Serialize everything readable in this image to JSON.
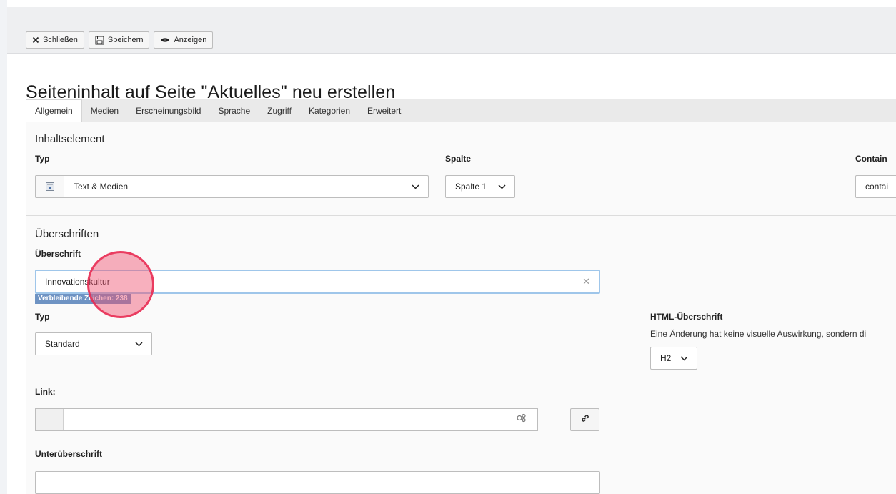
{
  "toolbar": {
    "close_label": "Schließen",
    "save_label": "Speichern",
    "view_label": "Anzeigen"
  },
  "page_title": "Seiteninhalt auf Seite \"Aktuelles\" neu erstellen",
  "tabs": [
    {
      "label": "Allgemein"
    },
    {
      "label": "Medien"
    },
    {
      "label": "Erscheinungsbild"
    },
    {
      "label": "Sprache"
    },
    {
      "label": "Zugriff"
    },
    {
      "label": "Kategorien"
    },
    {
      "label": "Erweitert"
    }
  ],
  "content_element": {
    "section_title": "Inhaltselement",
    "type_label": "Typ",
    "type_value": "Text & Medien",
    "column_label": "Spalte",
    "column_value": "Spalte 1",
    "container_label": "Contain",
    "container_value": "contai"
  },
  "headers": {
    "section_title": "Überschriften",
    "header_label": "Überschrift",
    "header_value": "Innovationskultur",
    "remaining_chars": "Verbleibende Zeichen: 238",
    "type_label": "Typ",
    "type_value": "Standard",
    "html_header_label": "HTML-Überschrift",
    "html_header_help": "Eine Änderung hat keine visuelle Auswirkung, sondern di",
    "html_header_value": "H2",
    "link_label": "Link:",
    "link_value": "",
    "subheader_label": "Unterüberschrift",
    "subheader_value": ""
  },
  "colors": {
    "accent_focus": "#9fc6ea",
    "badge": "#6e93c3",
    "cursor_highlight": "#f0506e"
  }
}
